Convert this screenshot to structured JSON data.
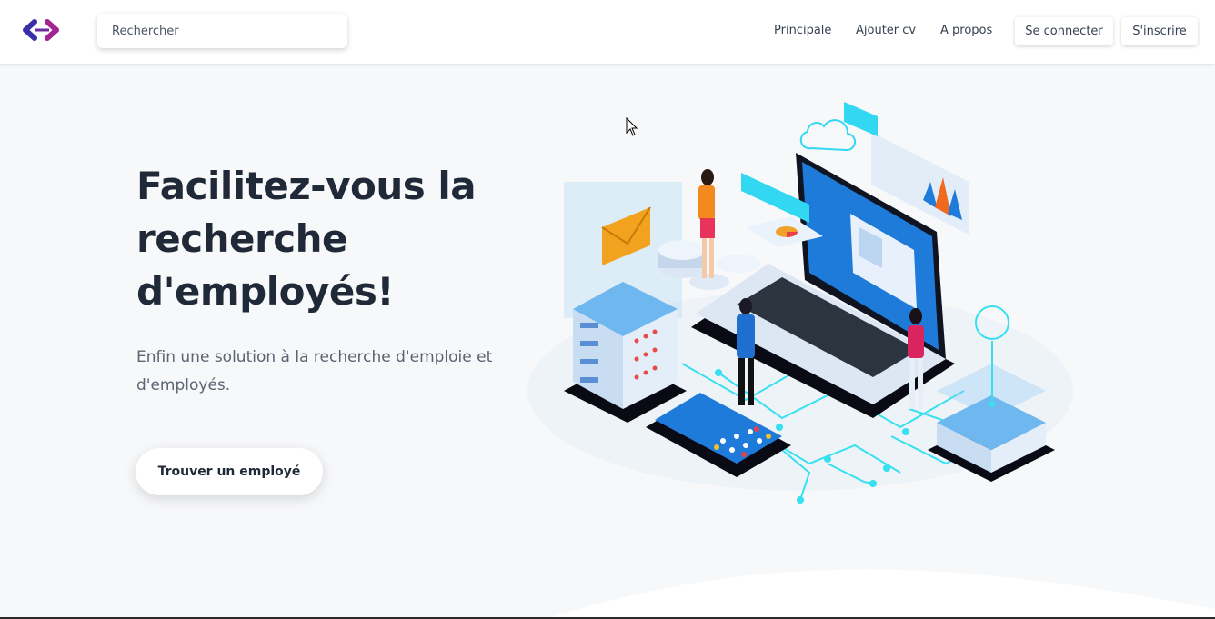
{
  "nav": {
    "logo_icon": "code-brackets-icon",
    "search_placeholder": "Rechercher",
    "links": [
      "Principale",
      "Ajouter cv",
      "A propos"
    ],
    "login_label": "Se connecter",
    "signup_label": "S'inscrire"
  },
  "hero": {
    "title": "Facilitez-vous la recherche d'employés!",
    "subtitle": "Enfin une solution à la recherche d'emploie et d'employés.",
    "cta_label": "Trouver un employé"
  },
  "colors": {
    "logo_blue": "#2f3bb5",
    "logo_magenta": "#a3258f",
    "accent_cyan": "#32d8f2",
    "screen_blue": "#1e7bd9"
  }
}
